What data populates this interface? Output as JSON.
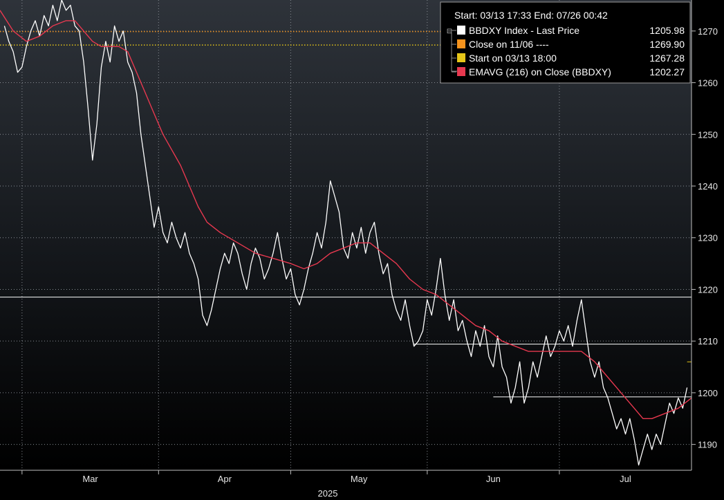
{
  "chart_data": {
    "type": "line",
    "x_range": [
      "2025-02-24",
      "2025-07-31"
    ],
    "ylim": [
      1185,
      1276
    ],
    "grid": true,
    "legend_position": "top-right",
    "yticks": [
      1190,
      1200,
      1210,
      1220,
      1230,
      1240,
      1250,
      1260,
      1270
    ],
    "xticks": [
      {
        "label": "Mar",
        "date": "2025-03-01"
      },
      {
        "label": "Apr",
        "date": "2025-04-01"
      },
      {
        "label": "May",
        "date": "2025-05-01"
      },
      {
        "label": "Jun",
        "date": "2025-06-01"
      },
      {
        "label": "Jul",
        "date": "2025-07-01"
      }
    ],
    "year_label": "2025",
    "header": "Start: 03/13 17:33 End: 07/26 00:42",
    "legend": [
      {
        "label": "BBDXY Index - Last Price",
        "value": "1205.98",
        "color": "#ffffff"
      },
      {
        "label": "Close on 11/06 ----",
        "value": "1269.90",
        "color": "#f7941d"
      },
      {
        "label": "Start on 03/13 18:00",
        "value": "1267.28",
        "color": "#e6c619"
      },
      {
        "label": "EMAVG (216)  on Close (BBDXY)",
        "value": "1202.27",
        "color": "#e8384f"
      }
    ],
    "series": [
      {
        "name": "BBDXY Index - Last Price",
        "color": "#ffffff",
        "points": [
          [
            "2025-02-25",
            1271
          ],
          [
            "2025-02-26",
            1268
          ],
          [
            "2025-02-27",
            1266
          ],
          [
            "2025-02-28",
            1262
          ],
          [
            "2025-03-01",
            1263
          ],
          [
            "2025-03-02",
            1267
          ],
          [
            "2025-03-03",
            1270
          ],
          [
            "2025-03-04",
            1272
          ],
          [
            "2025-03-05",
            1269
          ],
          [
            "2025-03-06",
            1273
          ],
          [
            "2025-03-07",
            1271
          ],
          [
            "2025-03-08",
            1275
          ],
          [
            "2025-03-09",
            1272
          ],
          [
            "2025-03-10",
            1276
          ],
          [
            "2025-03-11",
            1274
          ],
          [
            "2025-03-12",
            1275
          ],
          [
            "2025-03-13",
            1271
          ],
          [
            "2025-03-14",
            1270
          ],
          [
            "2025-03-15",
            1264
          ],
          [
            "2025-03-16",
            1255
          ],
          [
            "2025-03-17",
            1245
          ],
          [
            "2025-03-18",
            1252
          ],
          [
            "2025-03-19",
            1263
          ],
          [
            "2025-03-20",
            1268
          ],
          [
            "2025-03-21",
            1264
          ],
          [
            "2025-03-22",
            1271
          ],
          [
            "2025-03-23",
            1268
          ],
          [
            "2025-03-24",
            1270
          ],
          [
            "2025-03-25",
            1264
          ],
          [
            "2025-03-26",
            1262
          ],
          [
            "2025-03-27",
            1258
          ],
          [
            "2025-03-28",
            1250
          ],
          [
            "2025-03-29",
            1244
          ],
          [
            "2025-03-30",
            1238
          ],
          [
            "2025-03-31",
            1232
          ],
          [
            "2025-04-01",
            1236
          ],
          [
            "2025-04-02",
            1231
          ],
          [
            "2025-04-03",
            1229
          ],
          [
            "2025-04-04",
            1233
          ],
          [
            "2025-04-05",
            1230
          ],
          [
            "2025-04-06",
            1228
          ],
          [
            "2025-04-07",
            1231
          ],
          [
            "2025-04-08",
            1227
          ],
          [
            "2025-04-09",
            1225
          ],
          [
            "2025-04-10",
            1222
          ],
          [
            "2025-04-11",
            1215
          ],
          [
            "2025-04-12",
            1213
          ],
          [
            "2025-04-13",
            1216
          ],
          [
            "2025-04-14",
            1220
          ],
          [
            "2025-04-15",
            1224
          ],
          [
            "2025-04-16",
            1227
          ],
          [
            "2025-04-17",
            1225
          ],
          [
            "2025-04-18",
            1229
          ],
          [
            "2025-04-19",
            1227
          ],
          [
            "2025-04-20",
            1223
          ],
          [
            "2025-04-21",
            1220
          ],
          [
            "2025-04-22",
            1225
          ],
          [
            "2025-04-23",
            1228
          ],
          [
            "2025-04-24",
            1226
          ],
          [
            "2025-04-25",
            1222
          ],
          [
            "2025-04-26",
            1224
          ],
          [
            "2025-04-27",
            1227
          ],
          [
            "2025-04-28",
            1231
          ],
          [
            "2025-04-29",
            1226
          ],
          [
            "2025-04-30",
            1222
          ],
          [
            "2025-05-01",
            1224
          ],
          [
            "2025-05-02",
            1219
          ],
          [
            "2025-05-03",
            1217
          ],
          [
            "2025-05-04",
            1220
          ],
          [
            "2025-05-05",
            1224
          ],
          [
            "2025-05-06",
            1227
          ],
          [
            "2025-05-07",
            1231
          ],
          [
            "2025-05-08",
            1228
          ],
          [
            "2025-05-09",
            1233
          ],
          [
            "2025-05-10",
            1241
          ],
          [
            "2025-05-11",
            1238
          ],
          [
            "2025-05-12",
            1235
          ],
          [
            "2025-05-13",
            1228
          ],
          [
            "2025-05-14",
            1226
          ],
          [
            "2025-05-15",
            1231
          ],
          [
            "2025-05-16",
            1228
          ],
          [
            "2025-05-17",
            1232
          ],
          [
            "2025-05-18",
            1227
          ],
          [
            "2025-05-19",
            1231
          ],
          [
            "2025-05-20",
            1233
          ],
          [
            "2025-05-21",
            1227
          ],
          [
            "2025-05-22",
            1223
          ],
          [
            "2025-05-23",
            1225
          ],
          [
            "2025-05-24",
            1219
          ],
          [
            "2025-05-25",
            1216
          ],
          [
            "2025-05-26",
            1214
          ],
          [
            "2025-05-27",
            1218
          ],
          [
            "2025-05-28",
            1213
          ],
          [
            "2025-05-29",
            1209
          ],
          [
            "2025-05-30",
            1210
          ],
          [
            "2025-05-31",
            1212
          ],
          [
            "2025-06-01",
            1218
          ],
          [
            "2025-06-02",
            1215
          ],
          [
            "2025-06-03",
            1220
          ],
          [
            "2025-06-04",
            1226
          ],
          [
            "2025-06-05",
            1219
          ],
          [
            "2025-06-06",
            1214
          ],
          [
            "2025-06-07",
            1218
          ],
          [
            "2025-06-08",
            1212
          ],
          [
            "2025-06-09",
            1214
          ],
          [
            "2025-06-10",
            1210
          ],
          [
            "2025-06-11",
            1207
          ],
          [
            "2025-06-12",
            1212
          ],
          [
            "2025-06-13",
            1209
          ],
          [
            "2025-06-14",
            1213
          ],
          [
            "2025-06-15",
            1207
          ],
          [
            "2025-06-16",
            1205
          ],
          [
            "2025-06-17",
            1211
          ],
          [
            "2025-06-18",
            1205
          ],
          [
            "2025-06-19",
            1203
          ],
          [
            "2025-06-20",
            1198
          ],
          [
            "2025-06-21",
            1201
          ],
          [
            "2025-06-22",
            1206
          ],
          [
            "2025-06-23",
            1198
          ],
          [
            "2025-06-24",
            1201
          ],
          [
            "2025-06-25",
            1206
          ],
          [
            "2025-06-26",
            1203
          ],
          [
            "2025-06-27",
            1207
          ],
          [
            "2025-06-28",
            1211
          ],
          [
            "2025-06-29",
            1207
          ],
          [
            "2025-06-30",
            1209
          ],
          [
            "2025-07-01",
            1212
          ],
          [
            "2025-07-02",
            1210
          ],
          [
            "2025-07-03",
            1213
          ],
          [
            "2025-07-04",
            1209
          ],
          [
            "2025-07-05",
            1214
          ],
          [
            "2025-07-06",
            1218
          ],
          [
            "2025-07-07",
            1212
          ],
          [
            "2025-07-08",
            1206
          ],
          [
            "2025-07-09",
            1203
          ],
          [
            "2025-07-10",
            1206
          ],
          [
            "2025-07-11",
            1201
          ],
          [
            "2025-07-12",
            1199
          ],
          [
            "2025-07-13",
            1196
          ],
          [
            "2025-07-14",
            1193
          ],
          [
            "2025-07-15",
            1195
          ],
          [
            "2025-07-16",
            1192
          ],
          [
            "2025-07-17",
            1195
          ],
          [
            "2025-07-18",
            1191
          ],
          [
            "2025-07-19",
            1186
          ],
          [
            "2025-07-20",
            1189
          ],
          [
            "2025-07-21",
            1192
          ],
          [
            "2025-07-22",
            1189
          ],
          [
            "2025-07-23",
            1192
          ],
          [
            "2025-07-24",
            1190
          ],
          [
            "2025-07-25",
            1194
          ],
          [
            "2025-07-26",
            1198
          ],
          [
            "2025-07-27",
            1196
          ],
          [
            "2025-07-28",
            1199
          ],
          [
            "2025-07-29",
            1197
          ],
          [
            "2025-07-30",
            1201
          ]
        ]
      },
      {
        "name": "EMAVG (216)  on Close (BBDXY)",
        "color": "#e8384f",
        "points": [
          [
            "2025-02-24",
            1274
          ],
          [
            "2025-02-27",
            1270
          ],
          [
            "2025-03-02",
            1268
          ],
          [
            "2025-03-05",
            1269
          ],
          [
            "2025-03-08",
            1271
          ],
          [
            "2025-03-11",
            1272
          ],
          [
            "2025-03-13",
            1272
          ],
          [
            "2025-03-15",
            1270
          ],
          [
            "2025-03-17",
            1268
          ],
          [
            "2025-03-19",
            1267
          ],
          [
            "2025-03-21",
            1267
          ],
          [
            "2025-03-23",
            1267
          ],
          [
            "2025-03-25",
            1266
          ],
          [
            "2025-03-27",
            1262
          ],
          [
            "2025-03-29",
            1258
          ],
          [
            "2025-03-31",
            1254
          ],
          [
            "2025-04-02",
            1250
          ],
          [
            "2025-04-04",
            1247
          ],
          [
            "2025-04-06",
            1244
          ],
          [
            "2025-04-08",
            1240
          ],
          [
            "2025-04-10",
            1236
          ],
          [
            "2025-04-12",
            1233
          ],
          [
            "2025-04-15",
            1231
          ],
          [
            "2025-04-19",
            1229
          ],
          [
            "2025-04-23",
            1227
          ],
          [
            "2025-04-27",
            1226
          ],
          [
            "2025-05-01",
            1225
          ],
          [
            "2025-05-04",
            1224
          ],
          [
            "2025-05-07",
            1225
          ],
          [
            "2025-05-10",
            1227
          ],
          [
            "2025-05-13",
            1228
          ],
          [
            "2025-05-16",
            1229
          ],
          [
            "2025-05-19",
            1229
          ],
          [
            "2025-05-22",
            1227
          ],
          [
            "2025-05-25",
            1225
          ],
          [
            "2025-05-28",
            1222
          ],
          [
            "2025-05-31",
            1220
          ],
          [
            "2025-06-03",
            1219
          ],
          [
            "2025-06-06",
            1217
          ],
          [
            "2025-06-09",
            1215
          ],
          [
            "2025-06-12",
            1213
          ],
          [
            "2025-06-15",
            1212
          ],
          [
            "2025-06-18",
            1210
          ],
          [
            "2025-06-21",
            1209
          ],
          [
            "2025-06-24",
            1208
          ],
          [
            "2025-06-27",
            1208
          ],
          [
            "2025-06-30",
            1208
          ],
          [
            "2025-07-03",
            1208
          ],
          [
            "2025-07-06",
            1208
          ],
          [
            "2025-07-09",
            1206
          ],
          [
            "2025-07-12",
            1203
          ],
          [
            "2025-07-15",
            1200
          ],
          [
            "2025-07-18",
            1197
          ],
          [
            "2025-07-20",
            1195
          ],
          [
            "2025-07-22",
            1195
          ],
          [
            "2025-07-25",
            1196
          ],
          [
            "2025-07-28",
            1197
          ],
          [
            "2025-07-31",
            1199
          ]
        ]
      }
    ],
    "reference_lines": [
      {
        "value": 1269.9,
        "color": "#f7941d",
        "style": "dotted"
      },
      {
        "value": 1267.28,
        "color": "#e6c619",
        "style": "dotted"
      },
      {
        "value": 1218.5,
        "color": "#ffffff",
        "style": "solid"
      },
      {
        "value": 1209.4,
        "color": "#ffffff",
        "style": "solid",
        "from": "2025-05-29"
      },
      {
        "value": 1199.2,
        "color": "#ffffff",
        "style": "solid",
        "from": "2025-06-16"
      },
      {
        "value": 1205.98,
        "color": "#e6c619",
        "style": "solid",
        "from": "2025-07-30"
      }
    ]
  }
}
